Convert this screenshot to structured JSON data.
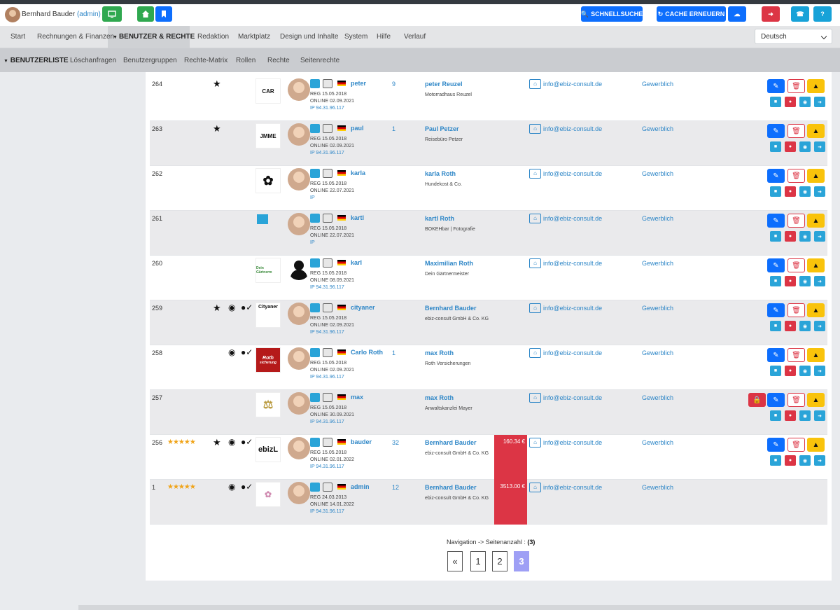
{
  "topbar": {
    "user_name": "Bernhard Bauder",
    "user_role": "(admin)",
    "quicksearch_label": "SCHNELLSUCHE",
    "cache_label": "CACHE ERNEUERN"
  },
  "nav": {
    "items": [
      "Start",
      "Rechnungen & Finanzen",
      "BENUTZER & RECHTE",
      "Redaktion",
      "Marktplatz",
      "Design und Inhalte",
      "System",
      "Hilfe",
      "Verlauf"
    ],
    "language": "Deutsch"
  },
  "subnav": {
    "items": [
      "BENUTZERLISTE",
      "Löschanfragen",
      "Benutzergruppen",
      "Rechte-Matrix",
      "Rollen",
      "Rechte",
      "Seitenrechte"
    ]
  },
  "rows": [
    {
      "id": "264",
      "username": "peter",
      "reg": "REG 15.05.2018",
      "online": "ONLINE 02.09.2021",
      "ip": "IP 94.31.96.117",
      "count": "9",
      "fullname": "peter Reuzel",
      "company": "Motorradhaus Reuzel",
      "email": "info@ebiz-consult.de",
      "type": "Gewerblich",
      "logo_text": "CAR",
      "logo_sub": "EXT SLOGAN HE"
    },
    {
      "id": "263",
      "username": "paul",
      "reg": "REG 15.05.2018",
      "online": "ONLINE 02.09.2021",
      "ip": "IP 94.31.96.117",
      "count": "1",
      "fullname": "Paul Petzer",
      "company": "Reisebüro Petzer",
      "email": "info@ebiz-consult.de",
      "type": "Gewerblich",
      "logo_text": "JMME",
      "logo_sub": "TRAVEL TIM"
    },
    {
      "id": "262",
      "username": "karla",
      "reg": "REG 15.05.2018",
      "online": "ONLINE 22.07.2021",
      "ip": "IP",
      "count": "",
      "fullname": "karla Roth",
      "company": "Hundekost & Co.",
      "email": "info@ebiz-consult.de",
      "type": "Gewerblich",
      "logo_text": "",
      "logo_sub": ""
    },
    {
      "id": "261",
      "username": "kartl",
      "reg": "REG 15.05.2018",
      "online": "ONLINE 22.07.2021",
      "ip": "IP",
      "count": "",
      "fullname": "kartl Roth",
      "company": "BOKEHbar | Fotografie",
      "email": "info@ebiz-consult.de",
      "type": "Gewerblich",
      "logo_text": "",
      "logo_sub": ""
    },
    {
      "id": "260",
      "username": "karl",
      "reg": "REG 15.05.2018",
      "online": "ONLINE 08.09.2021",
      "ip": "IP 94.31.96.117",
      "count": "",
      "fullname": "Maximilian Roth",
      "company": "Dein Gärtnermeister",
      "email": "info@ebiz-consult.de",
      "type": "Gewerblich",
      "logo_text": "Dein Gärtnerm",
      "logo_sub": ""
    },
    {
      "id": "259",
      "username": "cityaner",
      "reg": "REG 15.05.2018",
      "online": "ONLINE 02.09.2021",
      "ip": "IP 94.31.96.117",
      "count": "",
      "fullname": "Bernhard Bauder",
      "company": "ebiz-consult GmbH & Co. KG",
      "email": "info@ebiz-consult.de",
      "type": "Gewerblich",
      "logo_text": "Cityaner",
      "logo_sub": ""
    },
    {
      "id": "258",
      "username": "Carlo Roth",
      "reg": "REG 15.05.2018",
      "online": "ONLINE 02.09.2021",
      "ip": "IP 94.31.96.117",
      "count": "1",
      "fullname": "max Roth",
      "company": "Roth Versicherungen",
      "email": "info@ebiz-consult.de",
      "type": "Gewerblich",
      "logo_text": "Roth",
      "logo_sub": "sicherung"
    },
    {
      "id": "257",
      "username": "max",
      "reg": "REG 15.05.2018",
      "online": "ONLINE 30.09.2021",
      "ip": "IP 94.31.96.117",
      "count": "",
      "fullname": "max Roth",
      "company": "Anwaltskanzlei Mayer",
      "email": "info@ebiz-consult.de",
      "type": "Gewerblich",
      "logo_text": "",
      "logo_sub": ""
    },
    {
      "id": "256",
      "username": "bauder",
      "reg": "REG 15.05.2018",
      "online": "ONLINE 02.01.2022",
      "ip": "IP 94.31.96.117",
      "count": "32",
      "fullname": "Bernhard Bauder",
      "company": "ebiz-consult GmbH & Co. KG",
      "email": "info@ebiz-consult.de",
      "type": "Gewerblich",
      "balance": "160.34 €",
      "logo_text": "ebizL",
      "logo_sub": "",
      "stars": "★★★★★"
    },
    {
      "id": "1",
      "username": "admin",
      "reg": "REG 24.03.2013",
      "online": "ONLINE 14.01.2022",
      "ip": "IP 94.31.96.117",
      "count": "12",
      "fullname": "Bernhard Bauder",
      "company": "ebiz-consult GmbH & Co. KG",
      "email": "info@ebiz-consult.de",
      "type": "Gewerblich",
      "balance": "3513.00 €",
      "logo_text": "",
      "logo_sub": "",
      "stars": "★★★★★"
    }
  ],
  "pager": {
    "label": "Navigation -> Seitenanzahl :",
    "total": "(3)",
    "prev": "«",
    "pages": [
      "1",
      "2",
      "3"
    ],
    "active_page": "3"
  },
  "colors": {
    "primary": "#0d6efd",
    "danger": "#dc3545",
    "success": "#2fa84f",
    "warning": "#f9c30b",
    "info": "#17a2d8",
    "link": "#2d86c7"
  }
}
